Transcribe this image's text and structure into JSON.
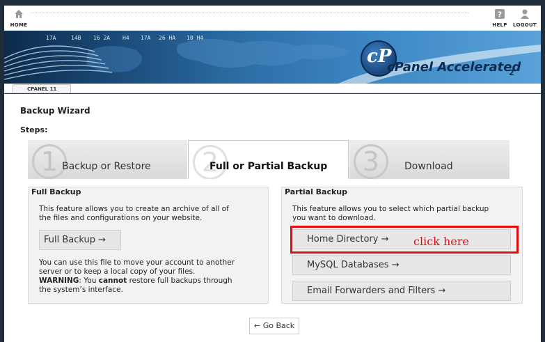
{
  "topbar": {
    "home_label": "HOME",
    "help_label": "HELP",
    "logout_label": "LOGOUT"
  },
  "banner": {
    "logo_letter": "cP",
    "brand": "cPanel Accelerated",
    "version_sub": "2",
    "tickers": [
      "17A",
      "14B",
      "16 2A",
      "H4",
      "17A",
      "26 HA",
      "10 H4"
    ]
  },
  "version_tab": "CPANEL 11",
  "page": {
    "title": "Backup Wizard",
    "steps_label": "Steps:"
  },
  "steps": [
    {
      "number": "1",
      "label": "Backup or Restore",
      "active": false
    },
    {
      "number": "2",
      "label": "Full or Partial Backup",
      "active": true
    },
    {
      "number": "3",
      "label": "Download",
      "active": false
    }
  ],
  "full_backup": {
    "heading": "Full Backup",
    "desc_line1": "This feature allows you to create an archive of all of",
    "desc_line2": "the files and configurations on your website.",
    "button": "Full Backup →",
    "note_line1": "You can use this file to move your account to another",
    "note_line2": "server or to keep a local copy of your files.",
    "warning_label": "WARNING",
    "warning_mid": ": You ",
    "warning_cannot": "cannot",
    "warning_rest": " restore full backups through",
    "note_line4": "the system’s interface."
  },
  "partial_backup": {
    "heading": "Partial Backup",
    "desc_line1": "This feature allows you to select which partial backup",
    "desc_line2": "you want to download.",
    "buttons": [
      "Home Directory →",
      "MySQL Databases →",
      "Email Forwarders and Filters →"
    ]
  },
  "annotation": {
    "text": "click here",
    "color": "#e01010"
  },
  "go_back": "← Go Back"
}
